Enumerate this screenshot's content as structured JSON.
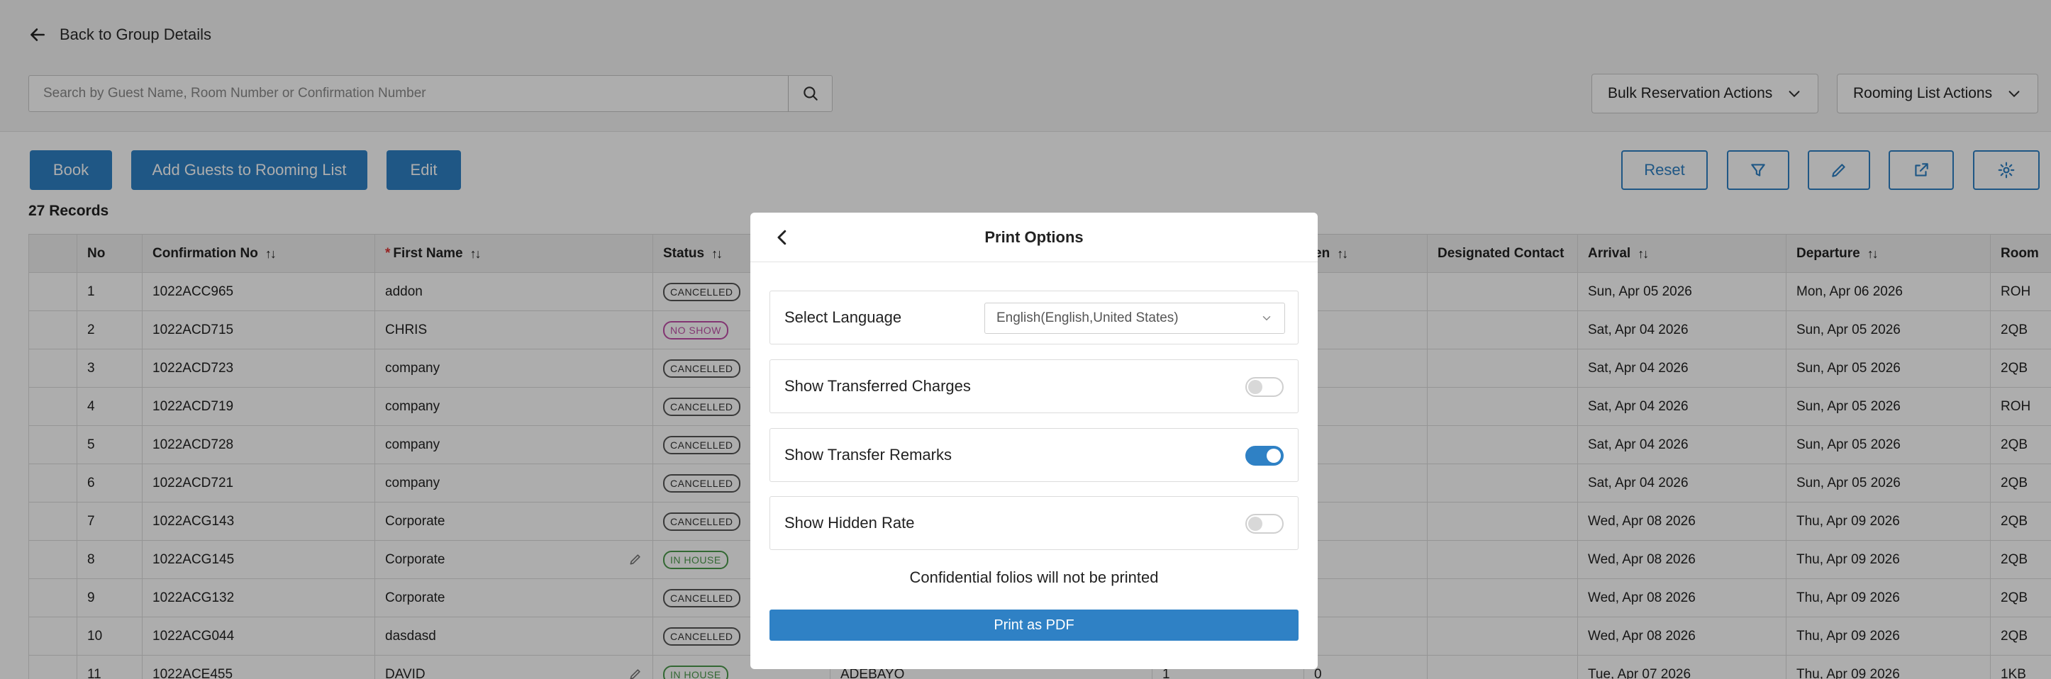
{
  "header": {
    "back_label": "Back to Group Details",
    "search_placeholder": "Search by Guest Name, Room Number or Confirmation Number"
  },
  "dropdowns": {
    "bulk": "Bulk Reservation Actions",
    "rooming": "Rooming List Actions"
  },
  "actions": {
    "book": "Book",
    "add_guests": "Add Guests to Rooming List",
    "edit": "Edit",
    "reset": "Reset"
  },
  "records": "27 Records",
  "table": {
    "headers": {
      "no": "No",
      "conf": "Confirmation No",
      "first": "First Name",
      "first_req": "*",
      "status": "Status",
      "children": "en",
      "designated": "Designated Contact",
      "arrival": "Arrival",
      "departure": "Departure",
      "room": "Room"
    },
    "rows": [
      {
        "no": "1",
        "conf": "1022ACC965",
        "first": "addon",
        "status": "CANCELLED",
        "arrival": "Sun, Apr 05 2026",
        "departure": "Mon, Apr 06 2026",
        "room": "ROH"
      },
      {
        "no": "2",
        "conf": "1022ACD715",
        "first": "CHRIS",
        "status": "NO SHOW",
        "arrival": "Sat, Apr 04 2026",
        "departure": "Sun, Apr 05 2026",
        "room": "2QB"
      },
      {
        "no": "3",
        "conf": "1022ACD723",
        "first": "company",
        "status": "CANCELLED",
        "arrival": "Sat, Apr 04 2026",
        "departure": "Sun, Apr 05 2026",
        "room": "2QB"
      },
      {
        "no": "4",
        "conf": "1022ACD719",
        "first": "company",
        "status": "CANCELLED",
        "arrival": "Sat, Apr 04 2026",
        "departure": "Sun, Apr 05 2026",
        "room": "ROH"
      },
      {
        "no": "5",
        "conf": "1022ACD728",
        "first": "company",
        "status": "CANCELLED",
        "arrival": "Sat, Apr 04 2026",
        "departure": "Sun, Apr 05 2026",
        "room": "2QB"
      },
      {
        "no": "6",
        "conf": "1022ACD721",
        "first": "company",
        "status": "CANCELLED",
        "arrival": "Sat, Apr 04 2026",
        "departure": "Sun, Apr 05 2026",
        "room": "2QB"
      },
      {
        "no": "7",
        "conf": "1022ACG143",
        "first": "Corporate",
        "status": "CANCELLED",
        "arrival": "Wed, Apr 08 2026",
        "departure": "Thu, Apr 09 2026",
        "room": "2QB"
      },
      {
        "no": "8",
        "conf": "1022ACG145",
        "first": "Corporate",
        "status": "IN HOUSE",
        "arrival": "Wed, Apr 08 2026",
        "departure": "Thu, Apr 09 2026",
        "room": "2QB"
      },
      {
        "no": "9",
        "conf": "1022ACG132",
        "first": "Corporate",
        "status": "CANCELLED",
        "arrival": "Wed, Apr 08 2026",
        "departure": "Thu, Apr 09 2026",
        "room": "2QB"
      },
      {
        "no": "10",
        "conf": "1022ACG044",
        "first": "dasdasd",
        "status": "CANCELLED",
        "arrival": "Wed, Apr 08 2026",
        "departure": "Thu, Apr 09 2026",
        "room": "2QB"
      },
      {
        "no": "11",
        "conf": "1022ACE455",
        "first": "DAVID",
        "status": "IN HOUSE",
        "last": "ADEBAYO",
        "c1": "1",
        "c2": "0",
        "arrival": "Tue, Apr 07 2026",
        "departure": "Thu, Apr 09 2026",
        "room": "1KB"
      }
    ]
  },
  "modal": {
    "title": "Print Options",
    "language_label": "Select Language",
    "language_value": "English(English,United States)",
    "opt_transferred": "Show Transferred Charges",
    "opt_remarks": "Show Transfer Remarks",
    "opt_hidden": "Show Hidden Rate",
    "toggles": {
      "transferred": false,
      "remarks": true,
      "hidden": false
    },
    "notice": "Confidential folios will not be printed",
    "print_btn": "Print as PDF"
  },
  "colors": {
    "accent": "#2f81c5",
    "overlay": "rgba(0,0,0,0.32)"
  }
}
